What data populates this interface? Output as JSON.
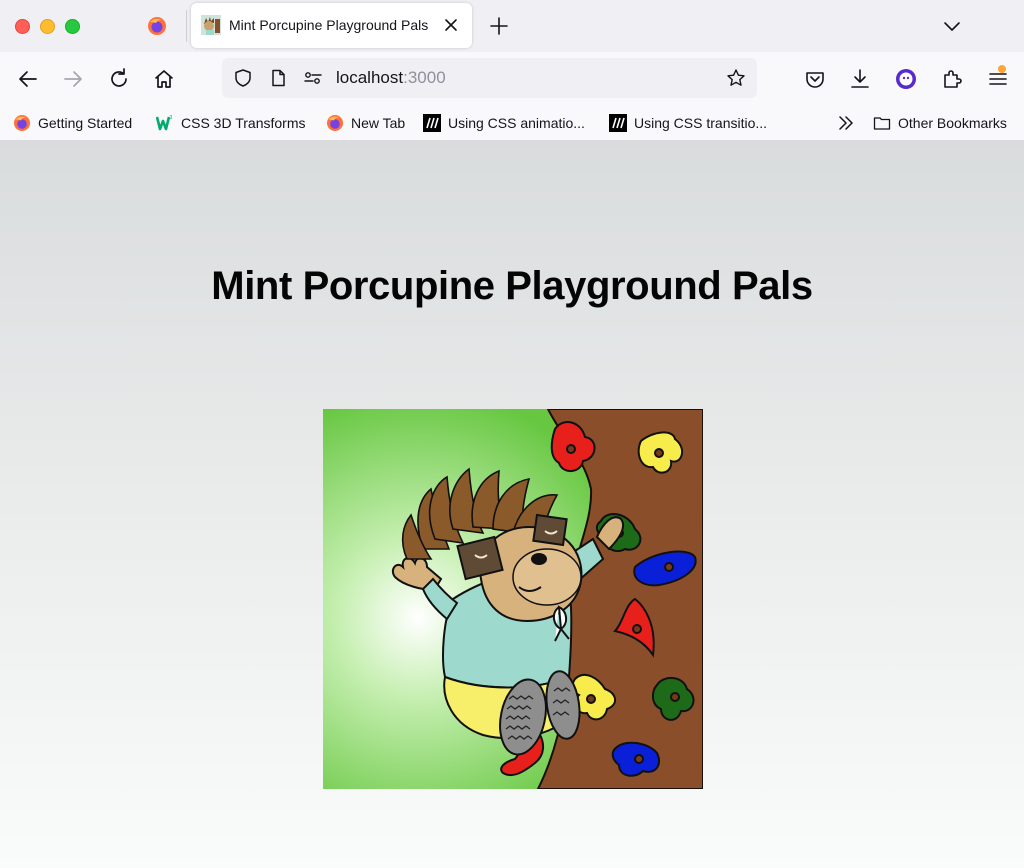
{
  "browser": {
    "tab": {
      "title": "Mint Porcupine Playground Pals"
    },
    "url": {
      "host": "localhost",
      "port": ":3000"
    },
    "bookmarks": [
      {
        "label": "Getting Started",
        "icon": "firefox-icon"
      },
      {
        "label": "CSS 3D Transforms",
        "icon": "w3schools-icon"
      },
      {
        "label": "New Tab",
        "icon": "firefox-icon"
      },
      {
        "label": "Using CSS animatio...",
        "icon": "mdn-icon"
      },
      {
        "label": "Using CSS transitio...",
        "icon": "mdn-icon"
      }
    ],
    "other_bookmarks": "Other Bookmarks"
  },
  "page": {
    "heading": "Mint Porcupine Playground Pals"
  },
  "colors": {
    "grass": "#67c741",
    "wall": "#8a4f2a",
    "shirt": "#9dd9cc",
    "shorts": "#f7ef6a"
  }
}
